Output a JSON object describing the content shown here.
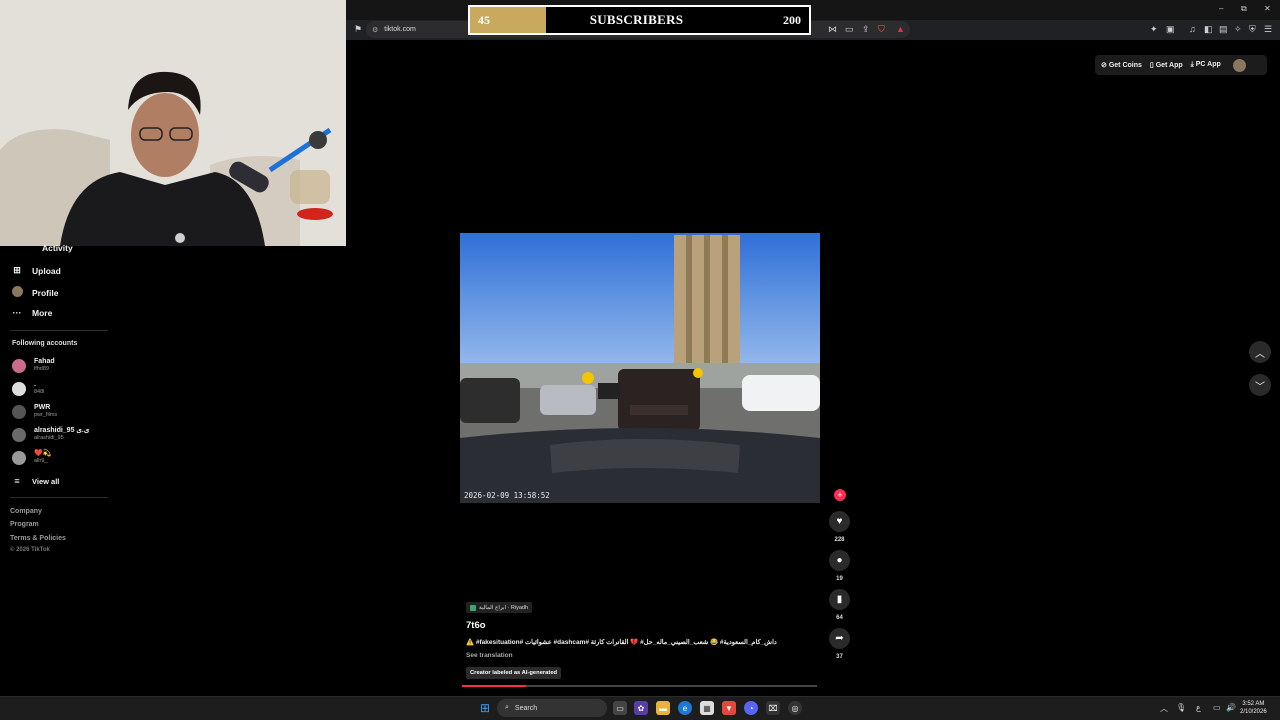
{
  "browser": {
    "url": "tiktok.com",
    "window_controls": {
      "minimize": "–",
      "restore": "⧉",
      "close": "✕"
    }
  },
  "overlay": {
    "subscriber_goal": {
      "current": "45",
      "title": "SUBSCRIBERS",
      "goal": "200",
      "progress_fraction": 0.225,
      "fill_color": "#c9a95e"
    }
  },
  "header": {
    "get_coins": "Get Coins",
    "get_app": "Get App",
    "pc_app": "PC App"
  },
  "sidebar": {
    "items": [
      {
        "label": "Activity",
        "icon": "activity-icon"
      },
      {
        "label": "Upload",
        "icon": "upload-icon"
      },
      {
        "label": "Profile",
        "icon": "avatar"
      },
      {
        "label": "More",
        "icon": "more-icon"
      }
    ],
    "following_title": "Following accounts",
    "accounts": [
      {
        "name": "Fahad",
        "handle": "lfhd89"
      },
      {
        "name": ".",
        "handle": "848l"
      },
      {
        "name": "PWR",
        "handle": "pwr_films"
      },
      {
        "name": "alrashidi_95 ی.ی",
        "handle": "alrashidi_95"
      },
      {
        "name": "❤️💫",
        "handle": "allr9_"
      }
    ],
    "view_all": "View all",
    "footer": [
      "Company",
      "Program",
      "Terms & Policies",
      "© 2026 TikTok"
    ]
  },
  "video": {
    "timestamp": "2026-02-09 13:58:52",
    "progress_fraction": 0.18
  },
  "actions": {
    "likes": "228",
    "comments": "19",
    "saves": "64",
    "shares": "37"
  },
  "post": {
    "location": "ابراج المالية · Riyadh",
    "author": "7t6o",
    "caption": "⚠️ #fakesituation# عشوائيات #dashcam# داش_كام_السعودية# 😂 شعب_الصيني_ماله_حل# 💔 القانرات كارثة",
    "see_translation": "See translation",
    "ai_label": "Creator labeled as AI-generated"
  },
  "taskbar": {
    "search": "Search",
    "time": "3:52 AM",
    "date": "2/10/2026",
    "lang": "ع"
  },
  "colors": {
    "accent": "#fe2c55",
    "bg": "#000000"
  }
}
